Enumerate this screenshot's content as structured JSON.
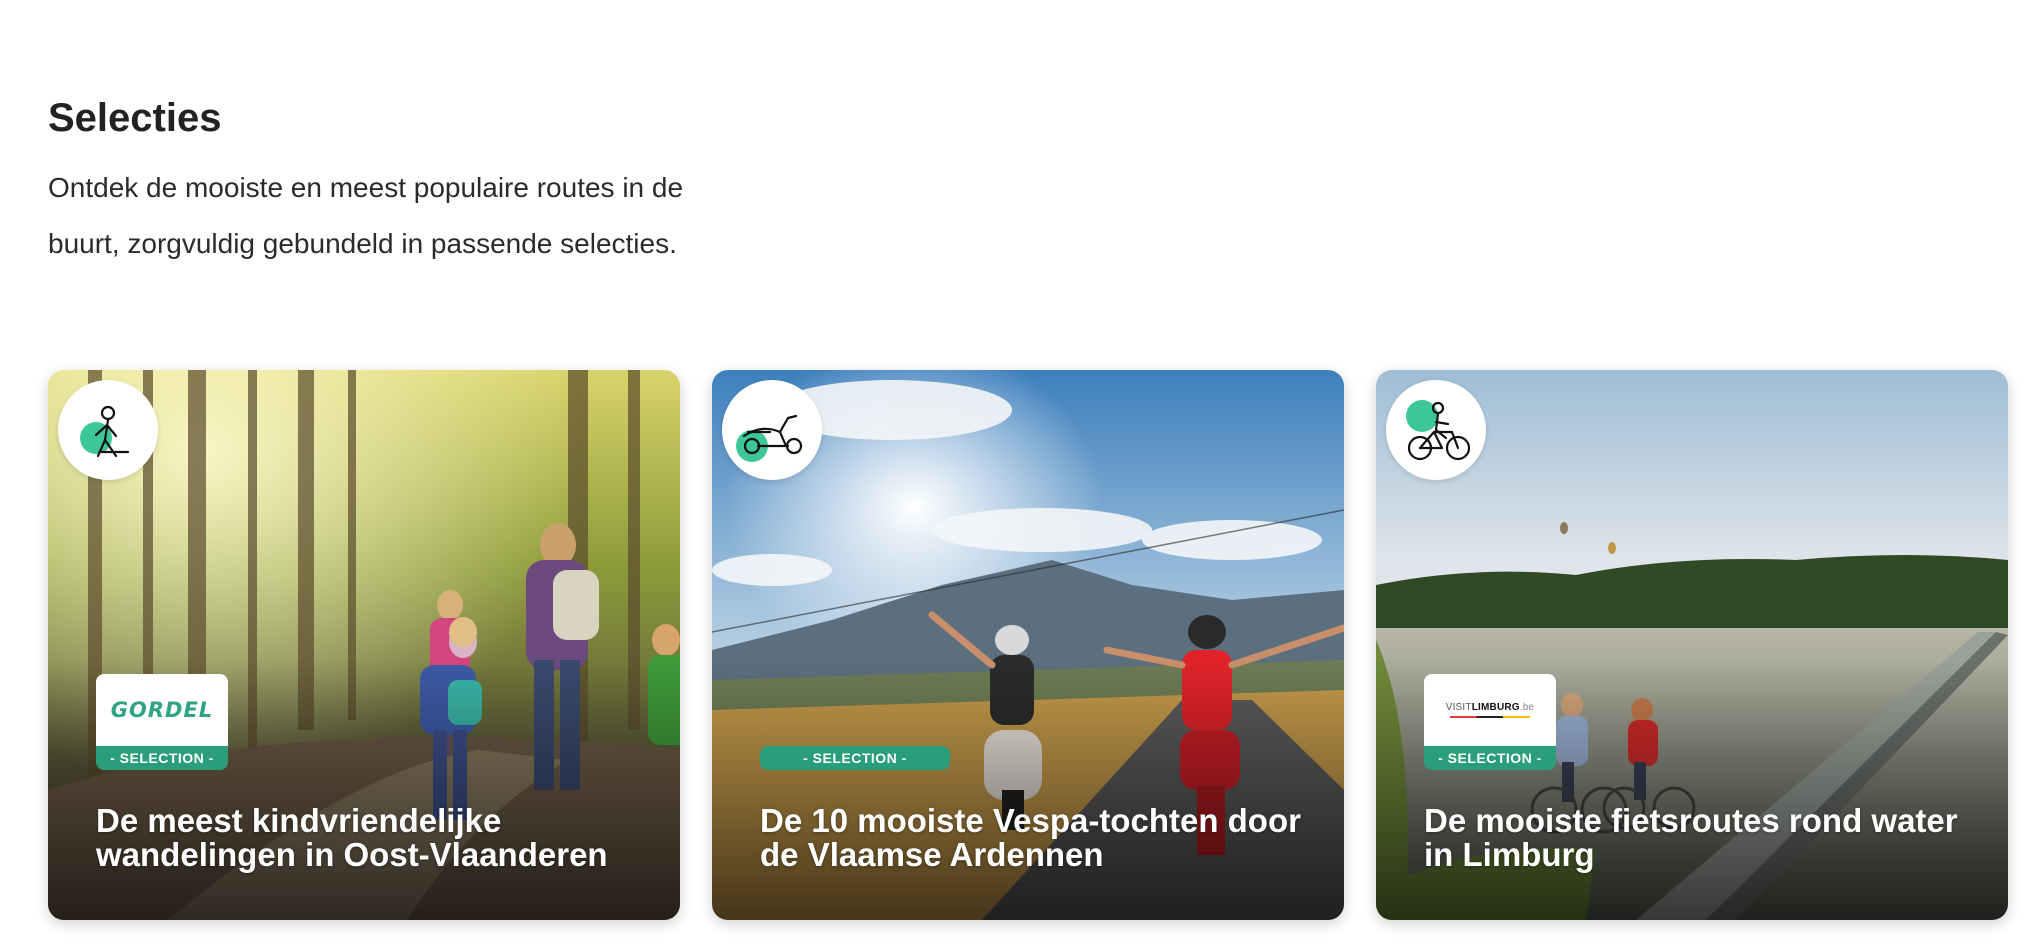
{
  "section": {
    "title": "Selecties",
    "description": "Ontdek de mooiste en meest populaire routes in de buurt, zorgvuldig gebundeld in passende selecties."
  },
  "accent_color": "#2a9d7b",
  "badge_circle_color": "#3cc69a",
  "cards": [
    {
      "title": "De meest kindvriendelijke wandelingen in Oost-Vlaanderen",
      "tag": "- SELECTION -",
      "activity_icon": "walking-icon",
      "partner_logo": "GORDEL",
      "image": "forest trail with family hiking"
    },
    {
      "title": "De 10 mooiste Vespa-tochten door de Vlaamse Ardennen",
      "tag": "- SELECTION -",
      "activity_icon": "scooter-icon",
      "image": "riders on scooters on a mountain road"
    },
    {
      "title": "De mooiste fietsroutes rond water in Limburg",
      "tag": "- SELECTION -",
      "activity_icon": "bicycle-icon",
      "partner_logo": {
        "prefix": "VISIT",
        "name": "LIMBURG",
        "suffix": ".be"
      },
      "image": "cyclists on a path through a lake"
    }
  ]
}
